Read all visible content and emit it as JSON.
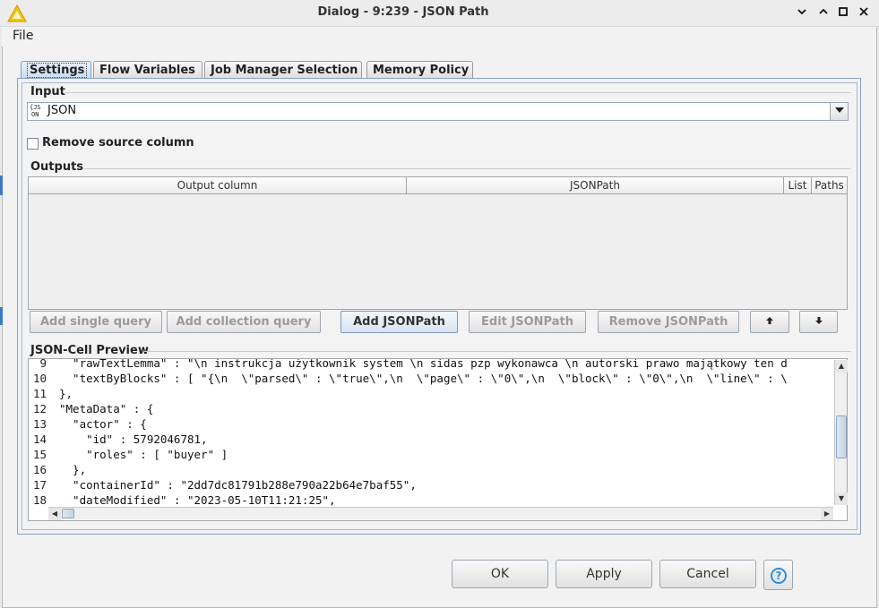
{
  "window": {
    "title": "Dialog - 9:239 - JSON Path"
  },
  "menu": {
    "file": "File"
  },
  "tabs": [
    {
      "label": "Settings",
      "active": true
    },
    {
      "label": "Flow Variables",
      "active": false
    },
    {
      "label": "Job Manager Selection",
      "active": false
    },
    {
      "label": "Memory Policy",
      "active": false
    }
  ],
  "input": {
    "group_label": "Input",
    "icon_text_top": "{JS",
    "icon_text_bottom": "ON",
    "selected": "JSON"
  },
  "remove_source": {
    "label": "Remove source column",
    "checked": false
  },
  "outputs": {
    "group_label": "Outputs",
    "columns": [
      "Output column",
      "JSONPath",
      "List",
      "Paths"
    ],
    "rows": []
  },
  "buttons": {
    "add_single": "Add single query",
    "add_collection": "Add collection query",
    "add_jsonpath": "Add JSONPath",
    "edit_jsonpath": "Edit JSONPath",
    "remove_jsonpath": "Remove JSONPath",
    "move_up": "⬆",
    "move_down": "⬇"
  },
  "preview": {
    "group_label": "JSON-Cell Preview",
    "lines": [
      {
        "n": "9",
        "text": "  \"rawTextLemma\" : \"\\n instrukcja użytkownik system \\n sidas pzp wykonawca \\n autorski prawo majątkowy ten d"
      },
      {
        "n": "10",
        "text": "  \"textByBlocks\" : [ \"{\\n  \\\"parsed\\\" : \\\"true\\\",\\n  \\\"page\\\" : \\\"0\\\",\\n  \\\"block\\\" : \\\"0\\\",\\n  \\\"line\\\" : \\"
      },
      {
        "n": "11",
        "text": "},"
      },
      {
        "n": "12",
        "text": "\"MetaData\" : {"
      },
      {
        "n": "13",
        "text": "  \"actor\" : {"
      },
      {
        "n": "14",
        "text": "    \"id\" : 5792046781,"
      },
      {
        "n": "15",
        "text": "    \"roles\" : [ \"buyer\" ]"
      },
      {
        "n": "16",
        "text": "  },"
      },
      {
        "n": "17",
        "text": "  \"containerId\" : \"2dd7dc81791b288e790a22b64e7baf55\","
      },
      {
        "n": "18",
        "text": "  \"dateModified\" : \"2023-05-10T11:21:25\","
      }
    ]
  },
  "footer": {
    "ok": "OK",
    "apply": "Apply",
    "cancel": "Cancel",
    "help": "?"
  },
  "colors": {
    "accent": "#2d8fdc",
    "tab_active": "#c9dcf0",
    "app_icon": "#f5c400"
  },
  "icons": {
    "app": "warning-triangle-icon",
    "minimize": "chevron-down-icon",
    "restore": "chevron-up-icon",
    "maximize": "square-icon",
    "close": "close-icon"
  }
}
